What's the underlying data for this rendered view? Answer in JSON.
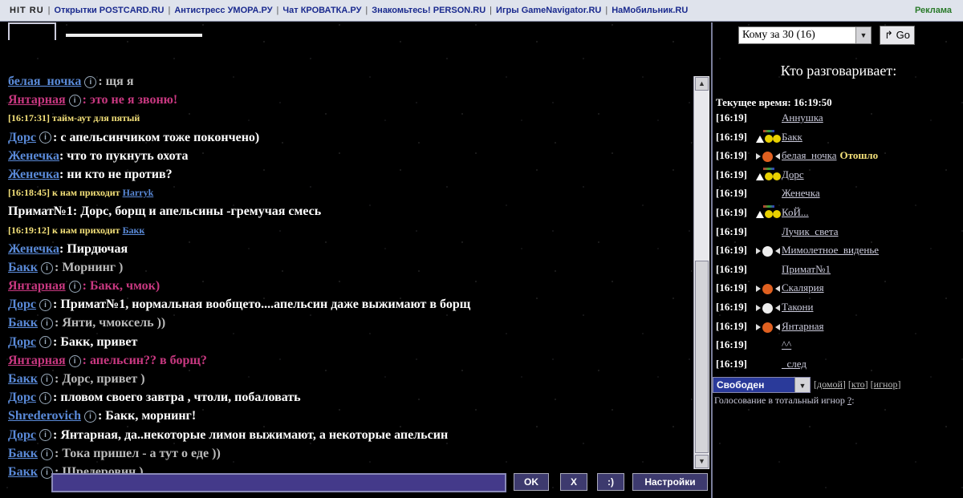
{
  "topbar": {
    "logo": "HIT RU",
    "links": [
      "Открытки POSTCARD.RU",
      "Антистресс УМОРА.РУ",
      "Чат КРОВАТКА.РУ",
      "Знакомьтесь! PERSON.RU",
      "Игры GameNavigator.RU",
      "НаМобильник.RU"
    ],
    "ad": "Реклама"
  },
  "chat": {
    "messages": [
      {
        "nick": "белая_ночка",
        "info": true,
        "text": ": щя я",
        "nick_style": "",
        "text_style": "grey"
      },
      {
        "nick": "Янтарная",
        "info": true,
        "text": ": это не я звоню!",
        "nick_style": "pink",
        "text_style": "pink"
      },
      {
        "sys": true,
        "time": "[16:17:31]",
        "text": "тайм-аут для пятый"
      },
      {
        "nick": "Дорс",
        "info": true,
        "text": ": с апельсинчиком тоже покончено)",
        "nick_style": "",
        "text_style": ""
      },
      {
        "nick": "Женечка",
        "info": false,
        "text": ": что то пукнуть охота",
        "nick_style": "",
        "text_style": ""
      },
      {
        "nick": "Женечка",
        "info": false,
        "text": ": ни кто не против?",
        "nick_style": "",
        "text_style": ""
      },
      {
        "sys": true,
        "time": "[16:18:45]",
        "text": "к нам приходит",
        "nick": "Harryk"
      },
      {
        "nick": "Примат№1",
        "info": false,
        "text": ": Дорс, борщ и апельсины -гремучая смесь",
        "nick_style": "plain",
        "text_style": ""
      },
      {
        "sys": true,
        "time": "[16:19:12]",
        "text": "к нам приходит",
        "nick": "Бакк"
      },
      {
        "nick": "Женечка",
        "info": false,
        "text": ": Пирдючая",
        "nick_style": "",
        "text_style": ""
      },
      {
        "nick": "Бакк",
        "info": true,
        "text": ": Морнинг )",
        "nick_style": "",
        "text_style": "grey"
      },
      {
        "nick": "Янтарная",
        "info": true,
        "text": ": Бакк, чмок)",
        "nick_style": "pink",
        "text_style": "pink"
      },
      {
        "nick": "Дорс",
        "info": true,
        "text": ": Примат№1, нормальная вообщето....апельсин даже выжимают в борщ",
        "nick_style": "",
        "text_style": ""
      },
      {
        "nick": "Бакк",
        "info": true,
        "text": ": Янти, чмоксель ))",
        "nick_style": "",
        "text_style": "grey"
      },
      {
        "nick": "Дорс",
        "info": true,
        "text": ": Бакк, привет",
        "nick_style": "",
        "text_style": ""
      },
      {
        "nick": "Янтарная",
        "info": true,
        "text": ": апельсин?? в борщ?",
        "nick_style": "pink",
        "text_style": "pink"
      },
      {
        "nick": "Бакк",
        "info": true,
        "text": ": Дорс, привет )",
        "nick_style": "",
        "text_style": "grey"
      },
      {
        "nick": "Дорс",
        "info": true,
        "text": ": пловом своего завтра , чтоли, побаловать",
        "nick_style": "",
        "text_style": ""
      },
      {
        "nick": "Shrederovich",
        "info": true,
        "text": ": Бакк, морнинг!",
        "nick_style": "",
        "text_style": ""
      },
      {
        "nick": "Дорс",
        "info": true,
        "text": ": Янтарная, да..некоторые лимон выжимают, а некоторые апельсин",
        "nick_style": "",
        "text_style": ""
      },
      {
        "nick": "Бакк",
        "info": true,
        "text": ": Тока пришел - а тут о еде ))",
        "nick_style": "",
        "text_style": "grey"
      },
      {
        "nick": "Бакк",
        "info": true,
        "text": ": Шредерович )",
        "nick_style": "",
        "text_style": "grey"
      }
    ],
    "info_glyph": "i"
  },
  "input": {
    "value": ""
  },
  "buttons": {
    "ok": "OK",
    "clear": "X",
    "smile": ":)",
    "settings": "Настройки"
  },
  "right": {
    "room": "Кому за 30 (16)",
    "go": "Go",
    "who_title": "Кто разговаривает:",
    "clock": "Текущее время: 16:19:50",
    "users": [
      {
        "time": "[16:19]",
        "name": "Аннушка",
        "icons": "",
        "note": ""
      },
      {
        "time": "[16:19]",
        "name": "Бакк",
        "icons": "stars",
        "note": ""
      },
      {
        "time": "[16:19]",
        "name": "белая_ночка",
        "icons": "orange",
        "note": "Отошло"
      },
      {
        "time": "[16:19]",
        "name": "Дорс",
        "icons": "stars",
        "note": ""
      },
      {
        "time": "[16:19]",
        "name": "Женечка",
        "icons": "",
        "note": ""
      },
      {
        "time": "[16:19]",
        "name": "КоЙ...",
        "icons": "stars",
        "note": ""
      },
      {
        "time": "[16:19]",
        "name": "Лучик_света",
        "icons": "",
        "note": ""
      },
      {
        "time": "[16:19]",
        "name": "Мимолетное_виденье",
        "icons": "white",
        "note": ""
      },
      {
        "time": "[16:19]",
        "name": "Примат№1",
        "icons": "",
        "note": ""
      },
      {
        "time": "[16:19]",
        "name": "Скалярия",
        "icons": "orange",
        "note": ""
      },
      {
        "time": "[16:19]",
        "name": "Такони",
        "icons": "white",
        "note": ""
      },
      {
        "time": "[16:19]",
        "name": "Янтарная",
        "icons": "orange",
        "note": ""
      },
      {
        "time": "[16:19]",
        "name": "^^",
        "icons": "",
        "note": ""
      },
      {
        "time": "[16:19]",
        "name": "_след",
        "icons": "",
        "note": ""
      }
    ],
    "status": "Свободен",
    "links": [
      "домой",
      "кто",
      "игнор"
    ],
    "vote_label": "Голосование в тотальный игнор",
    "vote_q": "?",
    "vote_colon": ":"
  },
  "colors": {
    "nick": "#5a8ad8",
    "pink": "#c83880",
    "system": "#f5e27a",
    "input_bg": "#443a8a"
  }
}
